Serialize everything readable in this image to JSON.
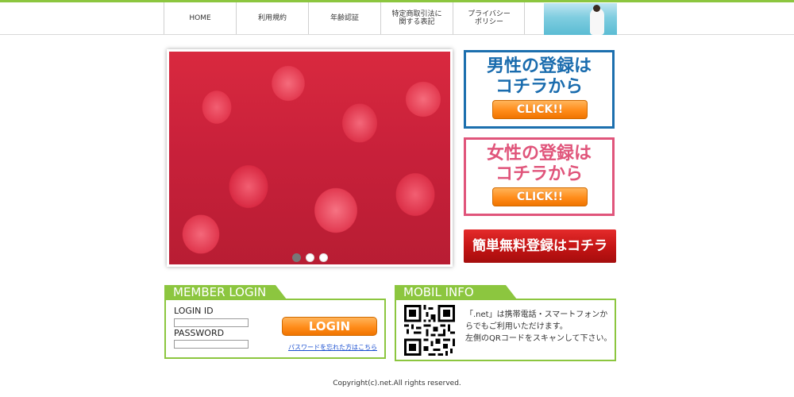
{
  "nav": {
    "items": [
      {
        "label": "HOME"
      },
      {
        "label": "利用規約"
      },
      {
        "label": "年齢認証"
      },
      {
        "label": "特定商取引法に\n関する表記"
      },
      {
        "label": "プライバシー\nポリシー"
      }
    ]
  },
  "slider": {
    "slide_count": 3,
    "active_index": 0
  },
  "register": {
    "male_text": "男性の登録は\nコチラから",
    "female_text": "女性の登録は\nコチラから",
    "click_label": "CLICK!!",
    "free_label": "簡単無料登録はコチラ",
    "colors": {
      "male": "#1c6fae",
      "female": "#e0557b",
      "free": "#c31414"
    }
  },
  "login": {
    "heading": "MEMBER LOGIN",
    "id_label": "LOGIN ID",
    "id_value": "",
    "password_label": "PASSWORD",
    "password_value": "",
    "button_label": "LOGIN",
    "forgot_link": "パスワードを忘れた方はこちら"
  },
  "mobile": {
    "heading": "MOBIL INFO",
    "text": "「.net」は携帯電話・スマートフォンか\nらでもご利用いただけます。\n左側のQRコードをスキャンして下さい。"
  },
  "footer": {
    "copyright": "Copyright(c).net.All rights reserved."
  },
  "theme": {
    "accent": "#8cc63f"
  }
}
